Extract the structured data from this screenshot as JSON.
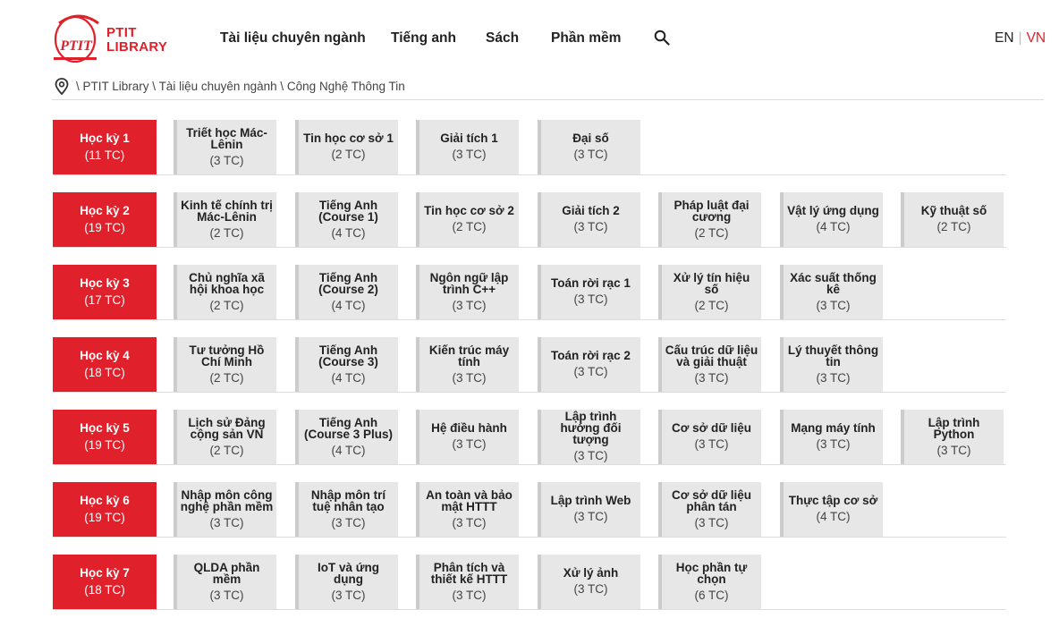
{
  "header": {
    "logo_text_line1": "PTIT",
    "logo_text_line2": "LIBRARY",
    "logo_mark": "PTIT",
    "nav": [
      "Tài liệu chuyên ngành",
      "Tiếng anh",
      "Sách",
      "Phần mềm"
    ],
    "search_icon": "search-icon",
    "lang_en": "EN",
    "lang_sep": "|",
    "lang_vn": "VN"
  },
  "colors": {
    "accent": "#e0202b",
    "card_bg": "#e7e7e7",
    "card_border": "#cccccc"
  },
  "breadcrumb": {
    "icon": "location-pin-icon",
    "items": [
      "PTIT Library",
      "Tài liệu chuyên ngành",
      "Công Nghệ Thông Tin"
    ]
  },
  "semesters": [
    {
      "title": "Học kỳ 1",
      "credits": "(11 TC)",
      "courses": [
        {
          "name": "Triết học Mác-Lênin",
          "credits": "(3 TC)"
        },
        {
          "name": "Tin học cơ sở 1",
          "credits": "(2 TC)"
        },
        {
          "name": "Giải tích 1",
          "credits": "(3 TC)"
        },
        {
          "name": "Đại số",
          "credits": "(3 TC)"
        }
      ]
    },
    {
      "title": "Học kỳ 2",
      "credits": "(19 TC)",
      "courses": [
        {
          "name": "Kinh tế chính trị Mác-Lênin",
          "credits": "(2 TC)"
        },
        {
          "name": "Tiếng Anh (Course 1)",
          "credits": "(4 TC)"
        },
        {
          "name": "Tin học cơ sở 2",
          "credits": "(2 TC)"
        },
        {
          "name": "Giải tích 2",
          "credits": "(3 TC)"
        },
        {
          "name": "Pháp luật đại cương",
          "credits": "(2 TC)"
        },
        {
          "name": "Vật lý ứng dụng",
          "credits": "(4 TC)"
        },
        {
          "name": "Kỹ thuật số",
          "credits": "(2 TC)"
        }
      ]
    },
    {
      "title": "Học kỳ 3",
      "credits": "(17 TC)",
      "courses": [
        {
          "name": "Chủ nghĩa xã hội khoa học",
          "credits": "(2 TC)"
        },
        {
          "name": "Tiếng Anh (Course 2)",
          "credits": "(4 TC)"
        },
        {
          "name": "Ngôn ngữ lập trình C++",
          "credits": "(3 TC)"
        },
        {
          "name": "Toán rời rạc 1",
          "credits": "(3 TC)"
        },
        {
          "name": "Xử lý tín hiệu số",
          "credits": "(2 TC)"
        },
        {
          "name": "Xác suất thống kê",
          "credits": "(3 TC)"
        }
      ]
    },
    {
      "title": "Học kỳ 4",
      "credits": "(18 TC)",
      "courses": [
        {
          "name": "Tư tưởng Hồ Chí Minh",
          "credits": "(2 TC)"
        },
        {
          "name": "Tiếng Anh (Course 3)",
          "credits": "(4 TC)"
        },
        {
          "name": "Kiến trúc máy tính",
          "credits": "(3 TC)"
        },
        {
          "name": "Toán rời rạc 2",
          "credits": "(3 TC)"
        },
        {
          "name": "Cấu trúc dữ liệu và giải thuật",
          "credits": "(3 TC)"
        },
        {
          "name": "Lý thuyết thông tin",
          "credits": "(3 TC)"
        }
      ]
    },
    {
      "title": "Học kỳ 5",
      "credits": "(19 TC)",
      "courses": [
        {
          "name": "Lịch sử Đảng cộng sản VN",
          "credits": "(2 TC)"
        },
        {
          "name": "Tiếng Anh (Course 3 Plus)",
          "credits": "(4 TC)"
        },
        {
          "name": "Hệ điều hành",
          "credits": "(3 TC)"
        },
        {
          "name": "Lập trình hướng đối tượng",
          "credits": "(3 TC)"
        },
        {
          "name": "Cơ sở dữ liệu",
          "credits": "(3 TC)"
        },
        {
          "name": "Mạng máy tính",
          "credits": "(3 TC)"
        },
        {
          "name": "Lập trình Python",
          "credits": "(3 TC)"
        }
      ]
    },
    {
      "title": "Học kỳ 6",
      "credits": "(19 TC)",
      "courses": [
        {
          "name": "Nhập môn công nghệ phần mềm",
          "credits": "(3 TC)"
        },
        {
          "name": "Nhập môn trí tuệ nhân tạo",
          "credits": "(3 TC)"
        },
        {
          "name": "An toàn và bảo mật HTTT",
          "credits": "(3 TC)"
        },
        {
          "name": "Lập trình Web",
          "credits": "(3 TC)"
        },
        {
          "name": "Cơ sở dữ liệu phân tán",
          "credits": "(3 TC)"
        },
        {
          "name": "Thực tập cơ sở",
          "credits": "(4 TC)"
        }
      ]
    },
    {
      "title": "Học kỳ 7",
      "credits": "(18 TC)",
      "courses": [
        {
          "name": "QLDA phần mềm",
          "credits": "(3 TC)"
        },
        {
          "name": "IoT và ứng dụng",
          "credits": "(3 TC)"
        },
        {
          "name": "Phân tích và thiết kế HTTT",
          "credits": "(3 TC)"
        },
        {
          "name": "Xử lý ảnh",
          "credits": "(3 TC)"
        },
        {
          "name": "Học phần tự chọn",
          "credits": "(6 TC)"
        }
      ]
    }
  ]
}
